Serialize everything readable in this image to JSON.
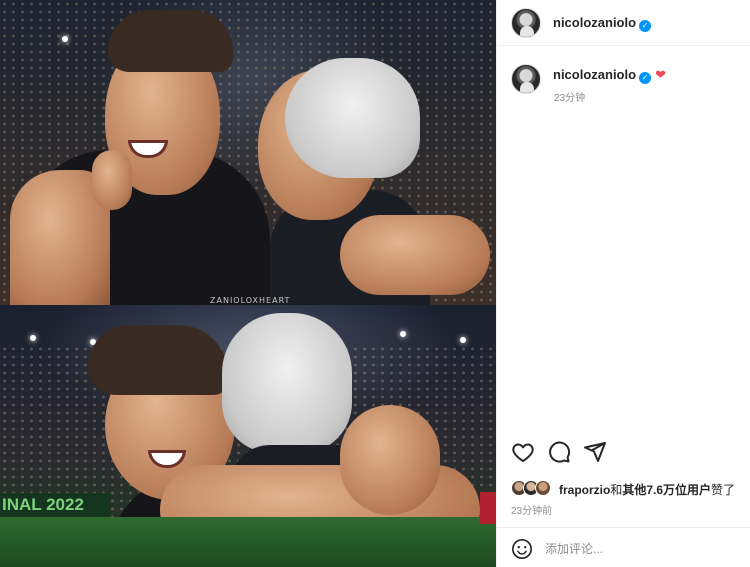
{
  "post": {
    "author": "nicolozaniolo",
    "caption_heart": "❤",
    "caption_time": "23分钟",
    "verified_mark": "✓",
    "watermark": "ZANIOLOXHEART",
    "banner_text": "INAL 2022"
  },
  "actions": {
    "like_icon": "heart-outline-icon",
    "comment_icon": "comment-icon",
    "share_icon": "share-icon"
  },
  "likes": {
    "first_user": "fraporzio",
    "connector": "和",
    "others": "其他7.6万位用户",
    "suffix": "赞了",
    "time": "23分钟前"
  },
  "comment": {
    "placeholder": "添加评论..."
  },
  "colors": {
    "verified": "#0095f6",
    "heart": "#ed4956",
    "muted": "#8e8e8e"
  }
}
